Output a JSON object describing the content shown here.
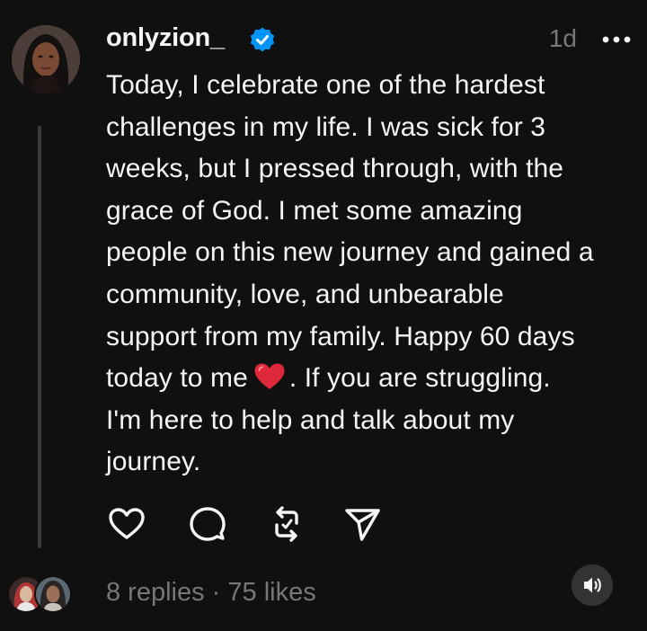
{
  "post": {
    "username": "onlyzion_",
    "verified": true,
    "timestamp": "1d",
    "text_lines": [
      "Today, I celebrate one of the hardest",
      "challenges in my life. I was sick for 3",
      "weeks, but I pressed through, with the",
      "grace of God. I met some amazing",
      "people on this new journey and gained a",
      "community, love, and unbearable",
      "support from my family. Happy 60 days",
      "today to me",
      ". If you are struggling.",
      "I'm here to help and talk about my",
      "journey."
    ],
    "emoji": "red-heart"
  },
  "actions": [
    {
      "name": "like",
      "icon": "heart-outline-icon"
    },
    {
      "name": "reply",
      "icon": "comment-bubble-icon"
    },
    {
      "name": "repost",
      "icon": "repost-arrows-icon"
    },
    {
      "name": "share",
      "icon": "send-paper-plane-icon"
    }
  ],
  "stats": {
    "replies": "8 replies",
    "separator": " · ",
    "likes": "75 likes"
  },
  "colors": {
    "background": "#101010",
    "text": "#f3f5f7",
    "muted": "#777777",
    "verified": "#0095f6",
    "heart": "#e0283c"
  },
  "icons": {
    "more": "more-dots-icon",
    "sound": "speaker-icon"
  }
}
